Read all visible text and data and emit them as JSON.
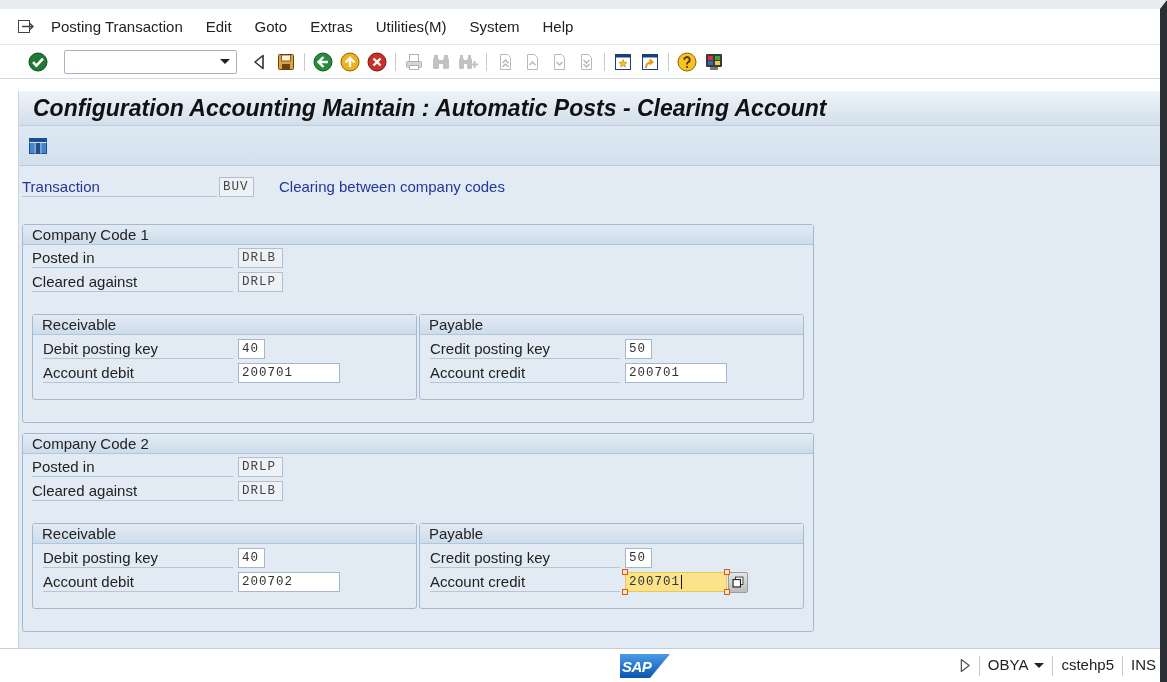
{
  "menu_bar": {
    "items": [
      {
        "label": "Posting Transaction"
      },
      {
        "label": "Edit"
      },
      {
        "label": "Goto"
      },
      {
        "label": "Extras"
      },
      {
        "label": "Utilities(M)"
      },
      {
        "label": "System"
      },
      {
        "label": "Help"
      }
    ]
  },
  "toolbar": {
    "groups": [
      [
        {
          "kind": "enter",
          "disabled": false
        }
      ],
      [
        {
          "kind": "collapse",
          "disabled": false
        },
        {
          "kind": "save",
          "disabled": false
        }
      ],
      [
        {
          "kind": "back",
          "disabled": false
        },
        {
          "kind": "exit",
          "disabled": false
        },
        {
          "kind": "cancel",
          "disabled": false
        }
      ],
      [
        {
          "kind": "print",
          "disabled": true
        },
        {
          "kind": "find",
          "disabled": true
        },
        {
          "kind": "find_next",
          "disabled": true
        }
      ],
      [
        {
          "kind": "first_page",
          "disabled": true
        },
        {
          "kind": "previous_page",
          "disabled": true
        },
        {
          "kind": "next_page",
          "disabled": true
        },
        {
          "kind": "last_page",
          "disabled": true
        }
      ],
      [
        {
          "kind": "new_session",
          "disabled": false
        },
        {
          "kind": "shortcut",
          "disabled": false
        }
      ],
      [
        {
          "kind": "help",
          "disabled": false
        },
        {
          "kind": "layout",
          "disabled": false
        }
      ]
    ]
  },
  "title": "Configuration Accounting Maintain : Automatic Posts - Clearing Account",
  "transaction": {
    "label": "Transaction",
    "value": "BUV",
    "description": "Clearing between company codes"
  },
  "company_codes": [
    {
      "title": "Company Code 1",
      "fields": [
        {
          "label": "Posted in",
          "value": "DRLB"
        },
        {
          "label": "Cleared against",
          "value": "DRLP"
        }
      ],
      "sections": [
        {
          "title": "Receivable",
          "fields": [
            {
              "label": "Debit posting key",
              "value": "40",
              "kind": "key",
              "focused": false
            },
            {
              "label": "Account debit",
              "value": "200701",
              "kind": "account",
              "focused": false
            }
          ]
        },
        {
          "title": "Payable",
          "fields": [
            {
              "label": "Credit posting key",
              "value": "50",
              "kind": "key",
              "focused": false
            },
            {
              "label": "Account credit",
              "value": "200701",
              "kind": "account",
              "focused": false
            }
          ]
        }
      ]
    },
    {
      "title": "Company Code 2",
      "fields": [
        {
          "label": "Posted in",
          "value": "DRLP"
        },
        {
          "label": "Cleared against",
          "value": "DRLB"
        }
      ],
      "sections": [
        {
          "title": "Receivable",
          "fields": [
            {
              "label": "Debit posting key",
              "value": "40",
              "kind": "key",
              "focused": false
            },
            {
              "label": "Account debit",
              "value": "200702",
              "kind": "account",
              "focused": false
            }
          ]
        },
        {
          "title": "Payable",
          "fields": [
            {
              "label": "Credit posting key",
              "value": "50",
              "kind": "key",
              "focused": false
            },
            {
              "label": "Account credit",
              "value": "200701",
              "kind": "account",
              "focused": true
            }
          ]
        }
      ]
    }
  ],
  "status_bar": {
    "logo": "SAP",
    "transaction": "OBYA",
    "system": "cstehp5",
    "mode": "INS"
  }
}
